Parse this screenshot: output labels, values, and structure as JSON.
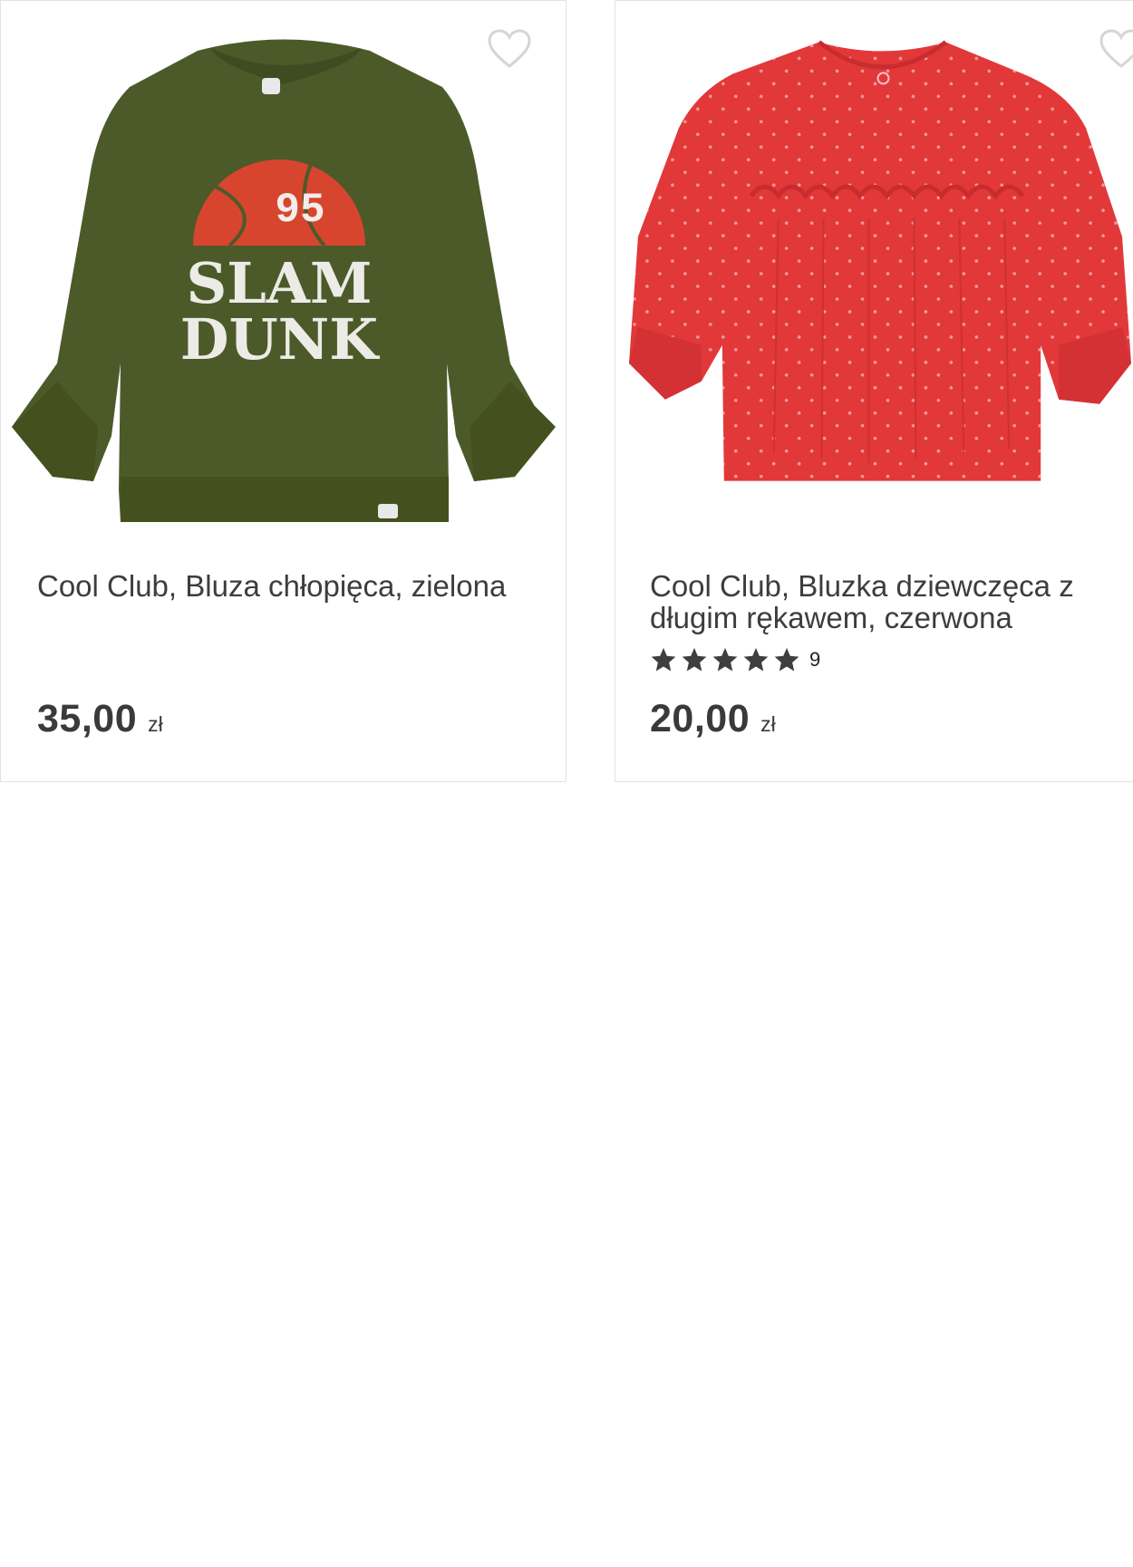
{
  "products": [
    {
      "title": "Cool Club, Bluza chłopięca, zielona",
      "price": "35,00",
      "currency": "zł",
      "image_graphic": {
        "top": "95",
        "line1": "SLAM",
        "line2": "DUNK"
      },
      "garment_color": "#4c5a2a"
    },
    {
      "title": "Cool Club, Bluzka dziewczęca z długim rękawem, czerwona",
      "price": "20,00",
      "currency": "zł",
      "rating_stars": 5,
      "rating_count": "9",
      "garment_color": "#e2383a"
    }
  ],
  "icons": {
    "favorite": "heart-outline-icon",
    "rating": "star-icon"
  },
  "colors": {
    "text": "#3d3d3d",
    "border": "#e3e3e3",
    "star": "#3f3f3f"
  }
}
